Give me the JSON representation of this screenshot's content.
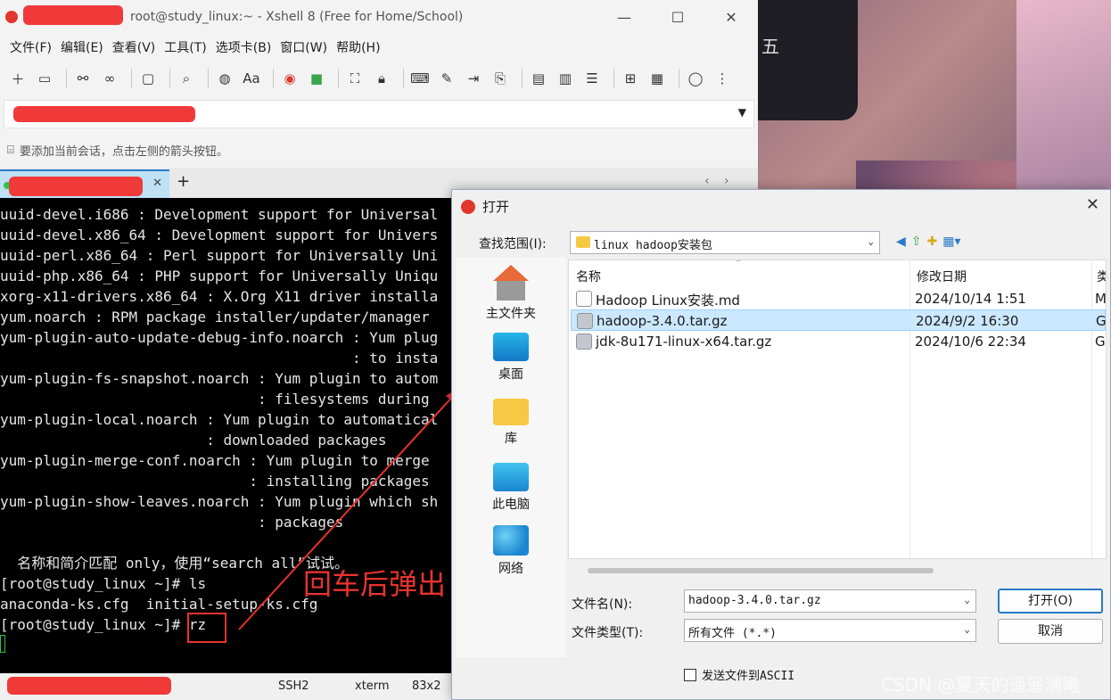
{
  "xshell": {
    "title": "root@study_linux:~ - Xshell 8 (Free for Home/School)",
    "menu": [
      "文件(F)",
      "编辑(E)",
      "查看(V)",
      "工具(T)",
      "选项卡(B)",
      "窗口(W)",
      "帮助(H)"
    ],
    "hint": "要添加当前会话，点击左侧的箭头按钮。",
    "terminal_lines": [
      "uuid-devel.i686 : Development support for Universal",
      "uuid-devel.x86_64 : Development support for Univers",
      "uuid-perl.x86_64 : Perl support for Universally Uni",
      "uuid-php.x86_64 : PHP support for Universally Uniqu",
      "xorg-x11-drivers.x86_64 : X.Org X11 driver installa",
      "yum.noarch : RPM package installer/updater/manager",
      "yum-plugin-auto-update-debug-info.noarch : Yum plug",
      "                                         : to insta",
      "yum-plugin-fs-snapshot.noarch : Yum plugin to autom",
      "                              : filesystems during ",
      "yum-plugin-local.noarch : Yum plugin to automatical",
      "                        : downloaded packages",
      "yum-plugin-merge-conf.noarch : Yum plugin to merge ",
      "                             : installing packages",
      "yum-plugin-show-leaves.noarch : Yum plugin which sh",
      "                              : packages",
      "",
      "  名称和简介匹配 only，使用“search all”试试。",
      "[root@study_linux ~]# ls",
      "anaconda-ks.cfg  initial-setup-ks.cfg",
      "[root@study_linux ~]# rz"
    ],
    "status": {
      "protocol": "SSH2",
      "term": "xterm",
      "size": "83x2"
    }
  },
  "annotation": "回车后弹出",
  "dialog": {
    "title": "打开",
    "look_in_label": "查找范围(I):",
    "look_in_value": "linux hadoop安装包",
    "places": [
      "主文件夹",
      "桌面",
      "库",
      "此电脑",
      "网络"
    ],
    "columns": [
      "名称",
      "修改日期",
      "类"
    ],
    "files": [
      {
        "name": "Hadoop Linux安装.md",
        "date": "2024/10/14 1:51",
        "type": "M"
      },
      {
        "name": "hadoop-3.4.0.tar.gz",
        "date": "2024/9/2 16:30",
        "type": "G"
      },
      {
        "name": "jdk-8u171-linux-x64.tar.gz",
        "date": "2024/10/6 22:34",
        "type": "G"
      }
    ],
    "filename_label": "文件名(N):",
    "filename_value": "hadoop-3.4.0.tar.gz",
    "filetype_label": "文件类型(T):",
    "filetype_value": "所有文件 (*.*)",
    "open_button": "打开(O)",
    "cancel_button": "取消",
    "ascii_label": "发送文件到ASCII"
  },
  "widget_text": "五",
  "watermark": "CSDN @夏天的遥遥漓曦"
}
